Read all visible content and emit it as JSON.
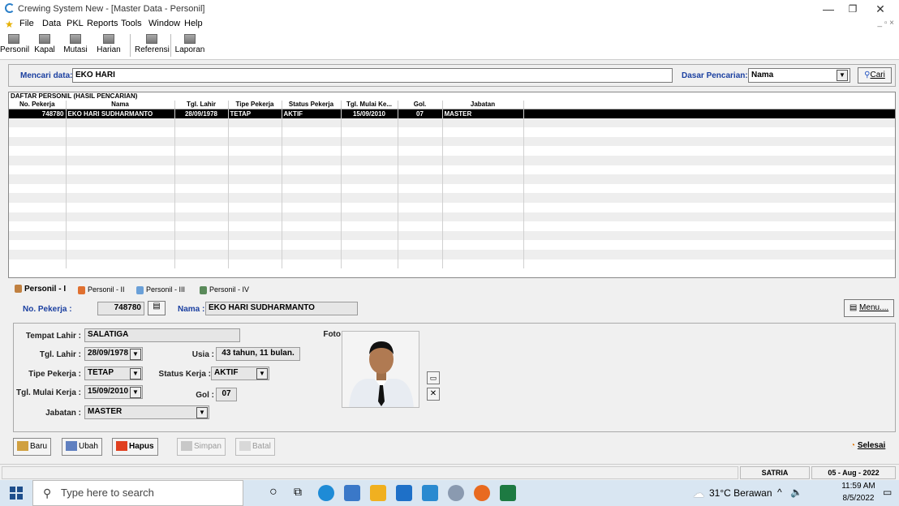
{
  "window": {
    "title": "Crewing System New - [Master Data - Personil]"
  },
  "menu": [
    {
      "label": "File"
    },
    {
      "label": "Data"
    },
    {
      "label": "PKL"
    },
    {
      "label": "Reports"
    },
    {
      "label": "Tools"
    },
    {
      "label": "Window"
    },
    {
      "label": "Help"
    }
  ],
  "toolbar": [
    {
      "label": "Personil"
    },
    {
      "label": "Kapal"
    },
    {
      "label": "Mutasi"
    },
    {
      "label": "Harian"
    },
    {
      "label": "Referensi"
    },
    {
      "label": "Laporan"
    }
  ],
  "search": {
    "label": "Mencari data:",
    "value": "EKO HARI",
    "basis_label": "Dasar Pencarian:",
    "basis_value": "Nama",
    "button_label": "Cari"
  },
  "grid": {
    "caption": "DAFTAR PERSONIL (HASIL PENCARIAN)",
    "columns": [
      "No. Pekerja",
      "Nama",
      "Tgl. Lahir",
      "Tipe Pekerja",
      "Status Pekerja",
      "Tgl. Mulai Ke...",
      "Gol.",
      "Jabatan"
    ],
    "rows": [
      {
        "no": "748780",
        "nama": "EKO HARI SUDHARMANTO",
        "lahir": "28/09/1978",
        "tipe": "TETAP",
        "status": "AKTIF",
        "mulai": "15/09/2010",
        "gol": "07",
        "jabatan": "MASTER"
      }
    ]
  },
  "tabs": [
    {
      "label": "Personil - I"
    },
    {
      "label": "Personil - II"
    },
    {
      "label": "Personil - III"
    },
    {
      "label": "Personil - IV"
    }
  ],
  "header": {
    "no_label": "No. Pekerja :",
    "no_value": "748780",
    "nama_label": "Nama :",
    "nama_value": "EKO HARI SUDHARMANTO",
    "menu_label": "Menu...."
  },
  "detail": {
    "tempat_label": "Tempat Lahir :",
    "tempat_value": "SALATIGA",
    "tgl_label": "Tgl. Lahir :",
    "tgl_value": "28/09/1978",
    "usia_label": "Usia :",
    "usia_value": "43 tahun, 11 bulan.",
    "tipe_label": "Tipe Pekerja :",
    "tipe_value": "TETAP",
    "status_label": "Status Kerja :",
    "status_value": "AKTIF",
    "mulai_label": "Tgl. Mulai Kerja :",
    "mulai_value": "15/09/2010",
    "gol_label": "Gol :",
    "gol_value": "07",
    "jabatan_label": "Jabatan :",
    "jabatan_value": "MASTER",
    "foto_label": "Foto"
  },
  "buttons": {
    "baru": "Baru",
    "ubah": "Ubah",
    "hapus": "Hapus",
    "simpan": "Simpan",
    "batal": "Batal",
    "selesai": "Selesai"
  },
  "status": {
    "user": "SATRIA",
    "date": "05 - Aug - 2022"
  },
  "taskbar": {
    "search_placeholder": "Type here to search",
    "weather": "31°C Berawan",
    "time": "11:59 AM",
    "date": "8/5/2022"
  },
  "colors": {
    "accent_blue": "#1a3fa0",
    "selected_row": "#000000"
  }
}
